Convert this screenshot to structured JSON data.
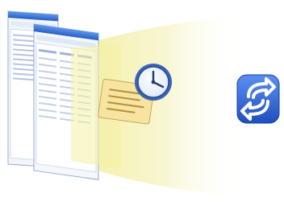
{
  "illustration": {
    "elements": [
      "stacked-app-windows",
      "light-beam",
      "document-note",
      "clock-icon",
      "sync-arrows-icon"
    ]
  },
  "colors": {
    "window_title_blue": "#2f6fd0",
    "beam_yellow": "#f3f0b0",
    "note_yellow": "#f7e7a3",
    "clock_blue": "#2e58a8",
    "sync_button_blue": "#2c5fd7"
  }
}
